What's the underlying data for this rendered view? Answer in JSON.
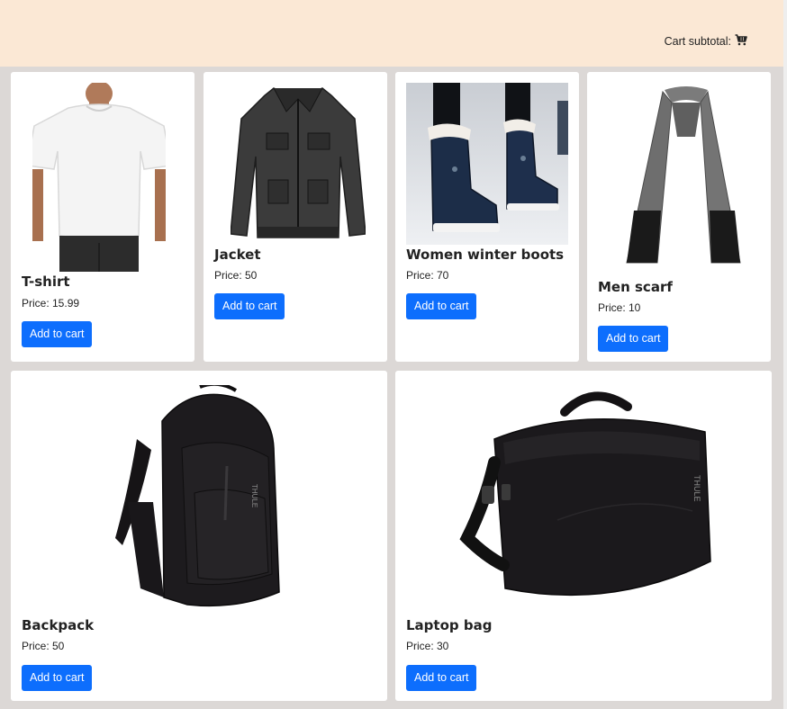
{
  "header": {
    "cart_subtotal_label": "Cart subtotal:",
    "cart_icon": "shopping-cart-icon"
  },
  "colors": {
    "header_bg": "#fbe8d5",
    "page_bg": "#dcd8d6",
    "button_bg": "#0d6efd"
  },
  "products": [
    {
      "name": "T-shirt",
      "price": "Price: 15.99",
      "button": "Add to cart",
      "image": "t-shirt-image"
    },
    {
      "name": "Jacket",
      "price": "Price: 50",
      "button": "Add to cart",
      "image": "jacket-image"
    },
    {
      "name": "Women winter boots",
      "price": "Price: 70",
      "button": "Add to cart",
      "image": "winter-boots-image"
    },
    {
      "name": "Men scarf",
      "price": "Price: 10",
      "button": "Add to cart",
      "image": "scarf-image"
    },
    {
      "name": "Backpack",
      "price": "Price: 50",
      "button": "Add to cart",
      "image": "backpack-image"
    },
    {
      "name": "Laptop bag",
      "price": "Price: 30",
      "button": "Add to cart",
      "image": "laptop-bag-image"
    }
  ]
}
